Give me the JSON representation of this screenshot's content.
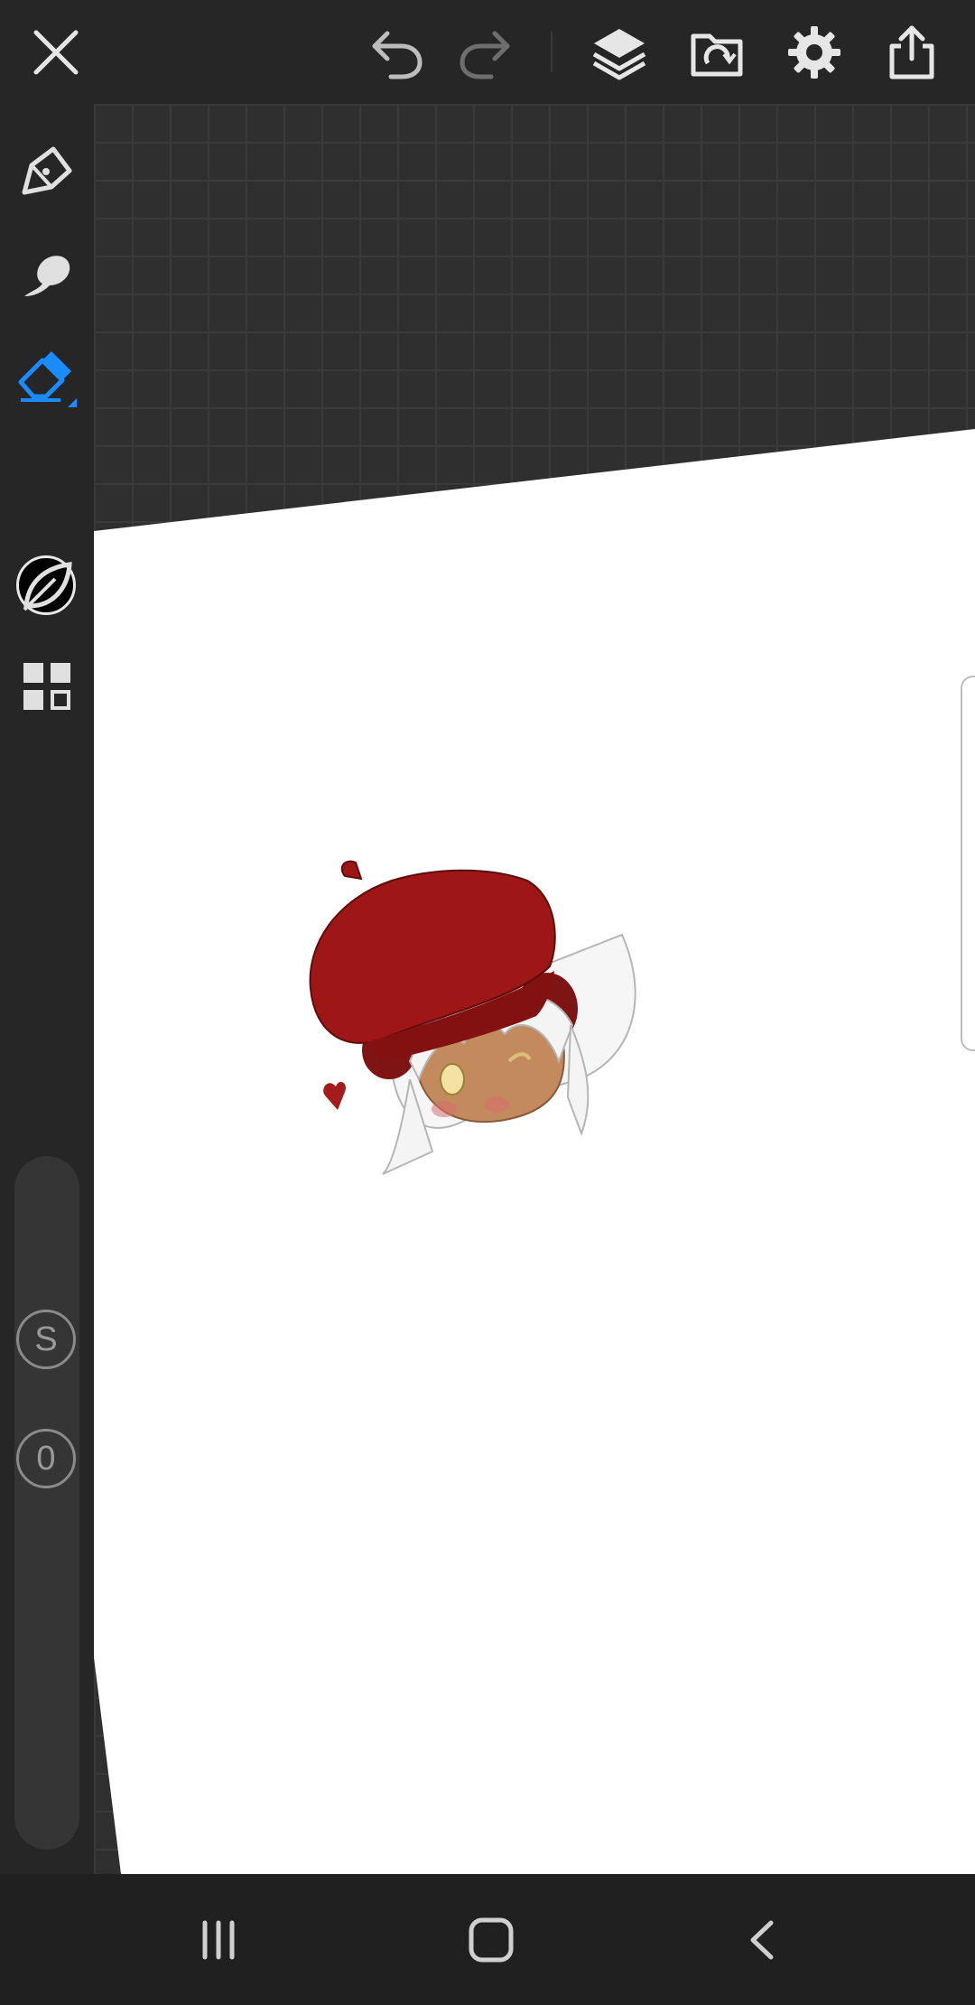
{
  "toolbar": {
    "close": "close-icon",
    "undo": "undo-icon",
    "redo": "redo-icon",
    "layers": "layers-icon",
    "gallery": "gallery-icon",
    "settings": "gear-icon",
    "export": "share-icon"
  },
  "sidebar": {
    "tools": [
      "pen-icon",
      "smudge-icon",
      "eraser-icon",
      "color-swatch",
      "leaf-icon",
      "grid-menu-icon"
    ],
    "selected_tool": "eraser",
    "current_color": "#000000",
    "stabilizer_label": "S",
    "opacity_label": "0"
  },
  "colors": {
    "accent": "#1a8cff",
    "toolbar_bg": "#262626",
    "canvas_bg": "#2f2f2f",
    "paper": "#ffffff",
    "beret": "#9b1414"
  },
  "navbar": {
    "recent": "recent-apps-icon",
    "home": "home-icon",
    "back": "back-icon"
  }
}
